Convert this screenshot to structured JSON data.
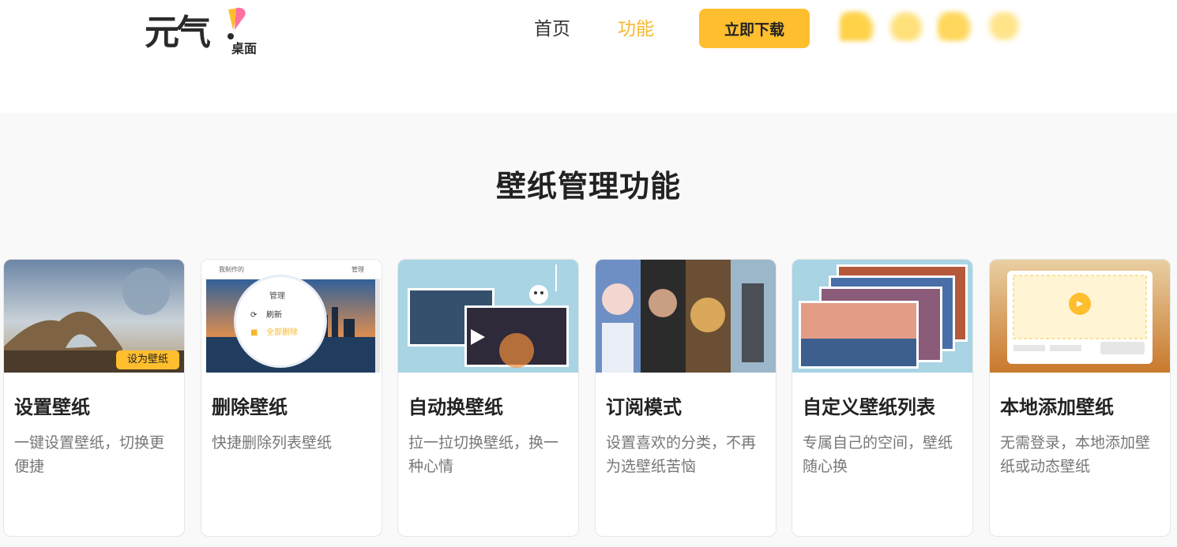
{
  "header": {
    "logo_text": "元气",
    "logo_sub": "桌面",
    "nav": [
      {
        "label": "首页"
      },
      {
        "label": "功能"
      }
    ],
    "download_label": "立即下载"
  },
  "section": {
    "title": "壁纸管理功能"
  },
  "cards": [
    {
      "title": "设置壁纸",
      "desc": "一键设置壁纸，切换更便捷",
      "tag": "设为壁纸"
    },
    {
      "title": "删除壁纸",
      "desc": "快捷删除列表壁纸",
      "mini_label": "我制作的",
      "manage": "管理",
      "refresh": "刷新",
      "delete_all": "全部删除"
    },
    {
      "title": "自动换壁纸",
      "desc": "拉一拉切换壁纸，换一种心情"
    },
    {
      "title": "订阅模式",
      "desc": "设置喜欢的分类，不再为选壁纸苦恼"
    },
    {
      "title": "自定义壁纸列表",
      "desc": "专属自己的空间，壁纸随心换"
    },
    {
      "title": "本地添加壁纸",
      "desc": "无需登录，本地添加壁纸或动态壁纸"
    }
  ],
  "colors": {
    "accent": "#ffbe2e",
    "nav_active": "#f5b82e",
    "section_bg": "#f9f9f9"
  }
}
